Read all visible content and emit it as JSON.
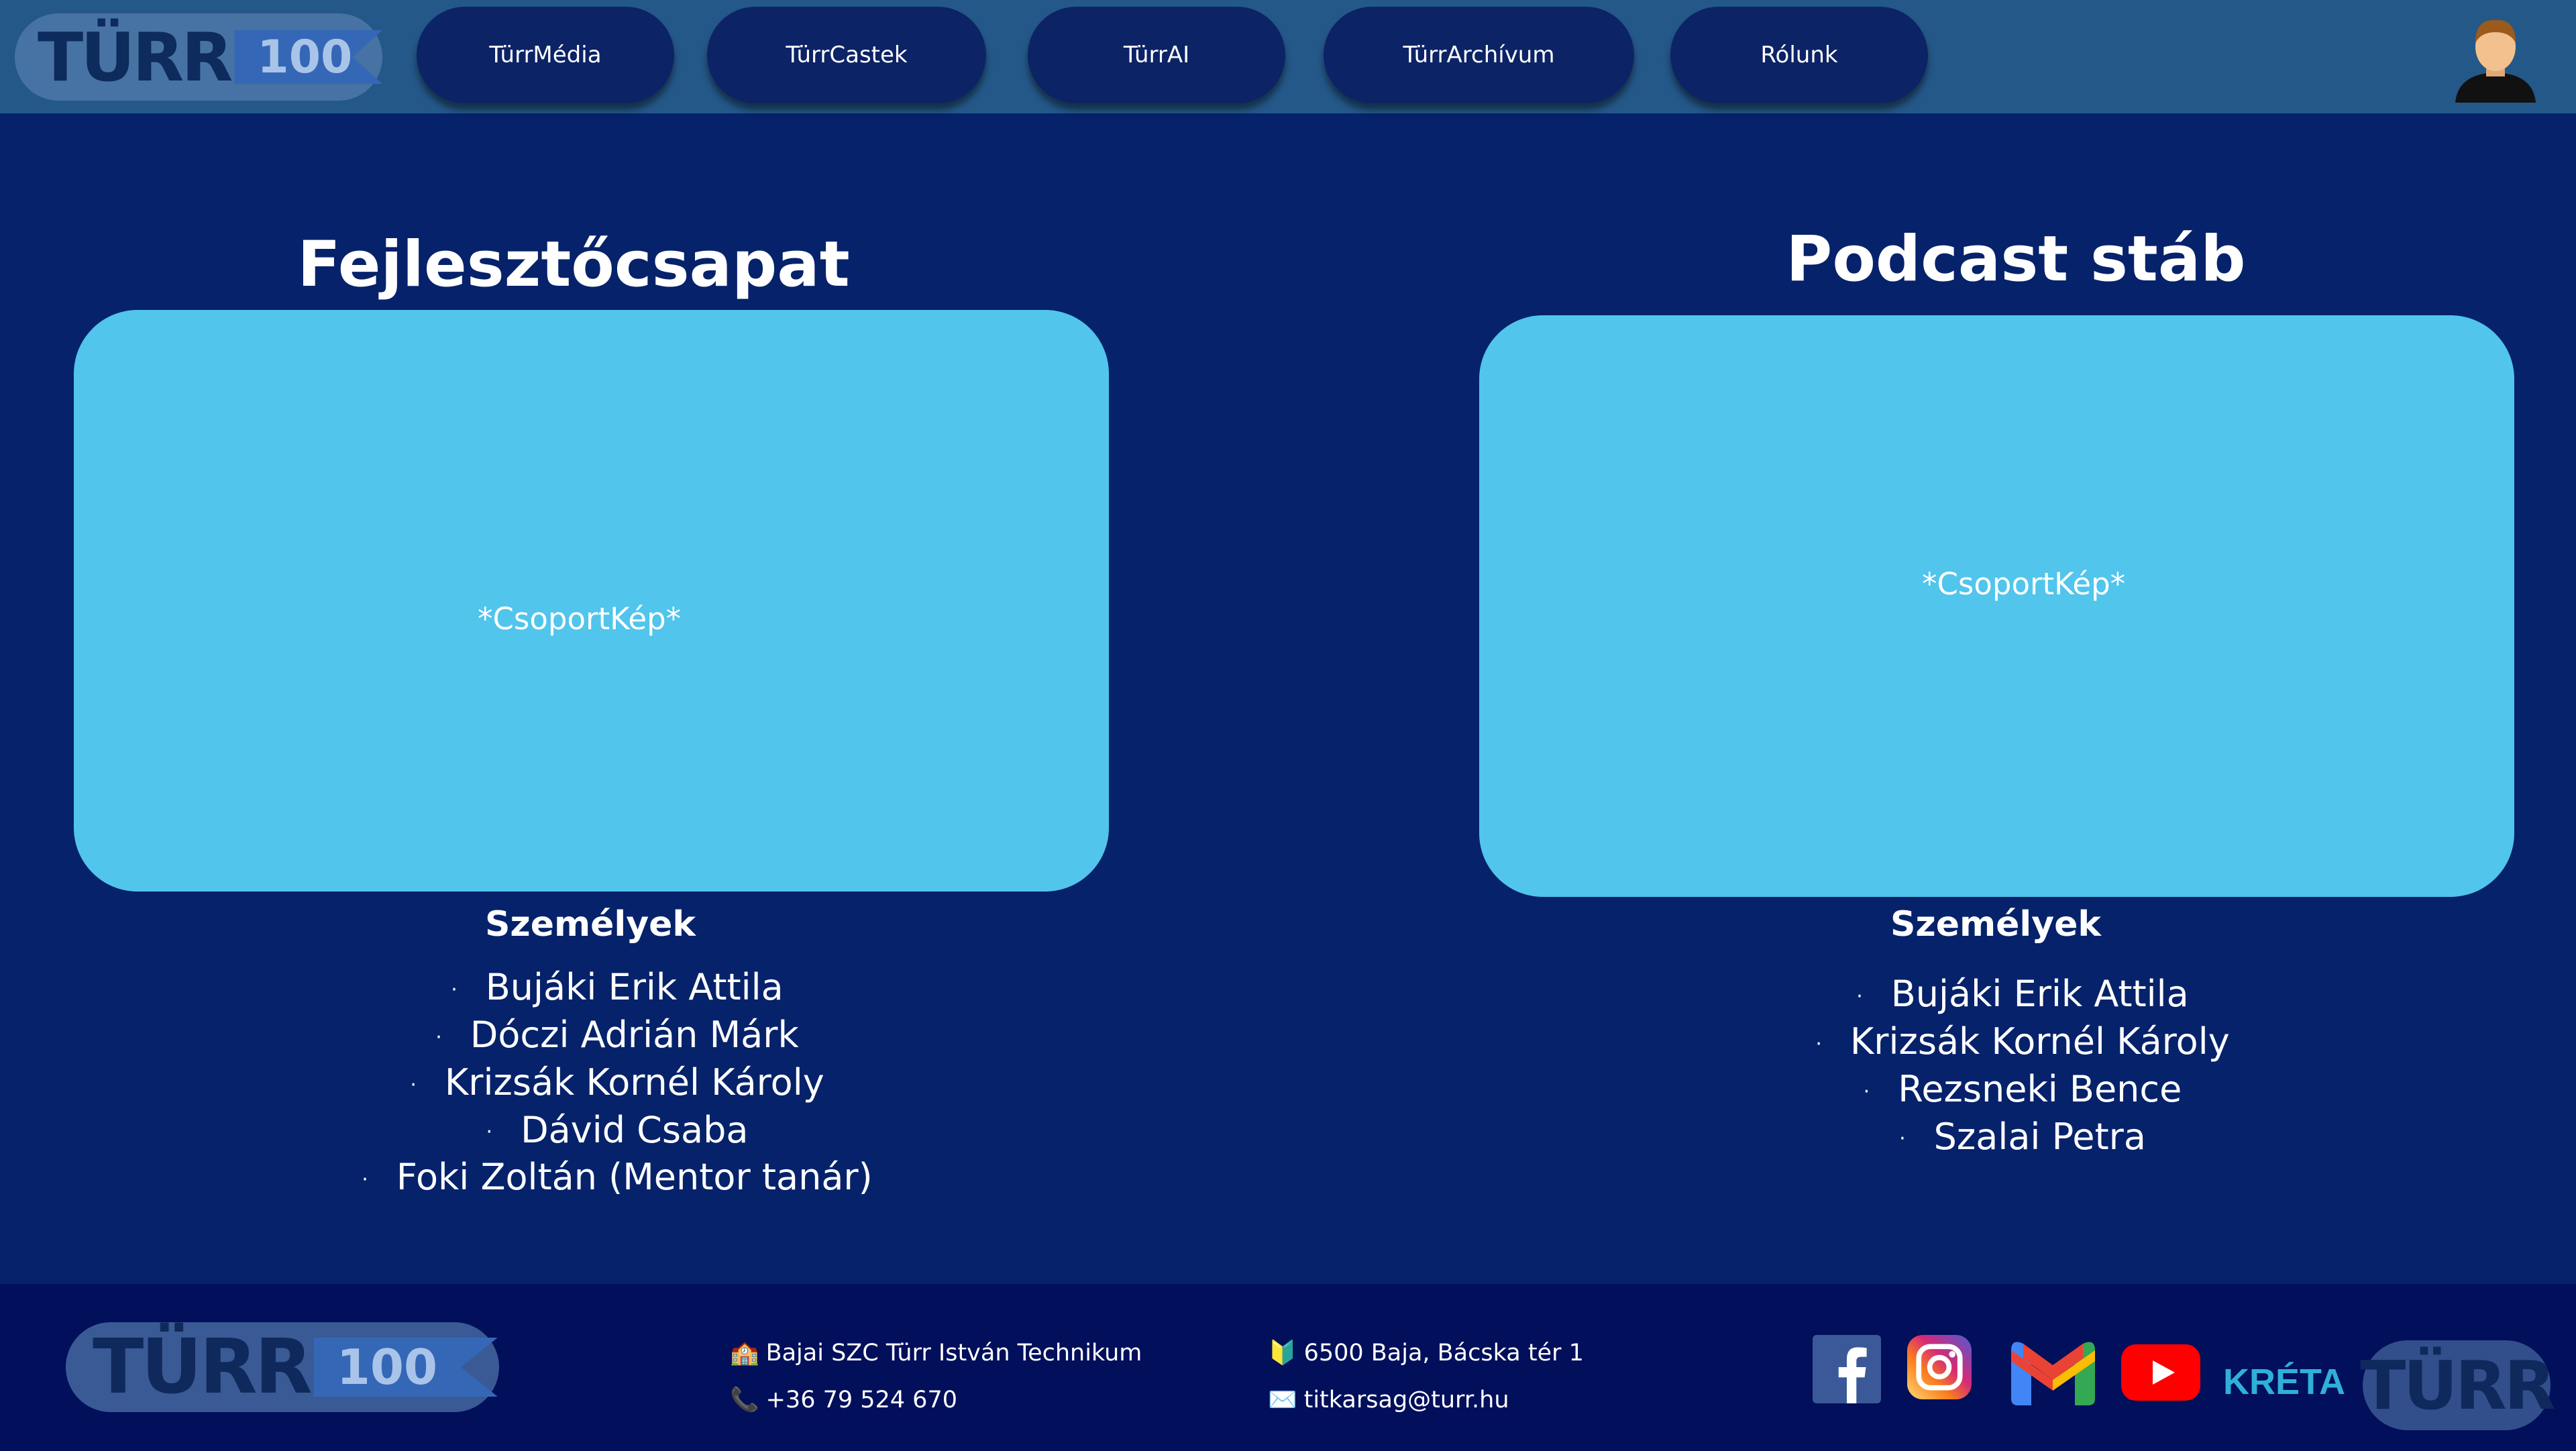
{
  "header": {
    "logo": {
      "text": "TÜRR",
      "number": "100"
    },
    "nav": [
      "TürrMédia",
      "TürrCastek",
      "TürrAI",
      "TürrArchívum",
      "Rólunk"
    ]
  },
  "sections": [
    {
      "title": "Fejlesztőcsapat",
      "photo_label": "*CsoportKép*",
      "people_title": "Személyek",
      "people": [
        "Bujáki Erik Attila",
        "Dóczi Adrián Márk",
        "Krizsák Kornél Károly",
        "Dávid Csaba",
        "Foki Zoltán (Mentor tanár)"
      ]
    },
    {
      "title": "Podcast stáb",
      "photo_label": "*CsoportKép*",
      "people_title": "Személyek",
      "people": [
        "Bujáki Erik Attila",
        "Krizsák Kornél Károly",
        "Rezsneki Bence",
        "Szalai Petra"
      ]
    }
  ],
  "footer": {
    "school": "Bajai SZC Türr István Technikum",
    "phone": "+36 79 524 670",
    "address": "6500 Baja, Bácska tér 1",
    "email": "titkarsag@turr.hu",
    "kreta": "KRÉTA",
    "logo_text": "TÜRR"
  },
  "colors": {
    "background": "#06226b",
    "header": "#245889",
    "nav_button": "#0c2366",
    "photo_box": "#51c5ec",
    "footer": "#020f5b"
  }
}
